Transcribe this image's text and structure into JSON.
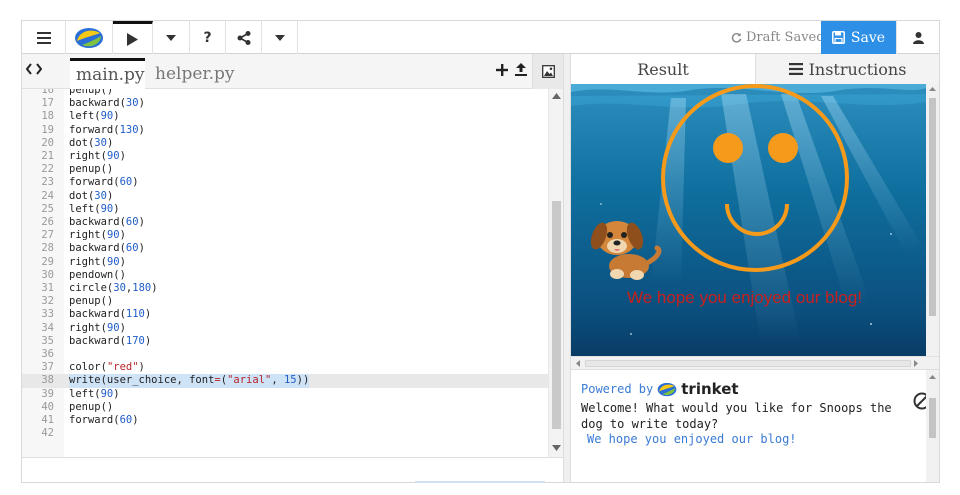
{
  "toolbar": {
    "items": [
      "menu-icon",
      "trinket-logo",
      "run-icon",
      "dropdown-icon",
      "help",
      "share-icon",
      "dropdown-icon"
    ],
    "help_label": "?",
    "draft_status": "Draft Saved",
    "save_label": "Save"
  },
  "editor": {
    "nav_arrows": "<>",
    "tabs": [
      {
        "label": "main.py",
        "active": true
      },
      {
        "label": "helper.py",
        "active": false
      }
    ],
    "lines": [
      {
        "n": "16",
        "code": "penup()"
      },
      {
        "n": "17",
        "code": "backward(30)"
      },
      {
        "n": "18",
        "code": "left(90)"
      },
      {
        "n": "19",
        "code": "forward(130)"
      },
      {
        "n": "20",
        "code": "dot(30)"
      },
      {
        "n": "21",
        "code": "right(90)"
      },
      {
        "n": "22",
        "code": "penup()"
      },
      {
        "n": "23",
        "code": "forward(60)"
      },
      {
        "n": "24",
        "code": "dot(30)"
      },
      {
        "n": "25",
        "code": "left(90)"
      },
      {
        "n": "26",
        "code": "backward(60)"
      },
      {
        "n": "27",
        "code": "right(90)"
      },
      {
        "n": "28",
        "code": "backward(60)"
      },
      {
        "n": "29",
        "code": "right(90)"
      },
      {
        "n": "30",
        "code": "pendown()"
      },
      {
        "n": "31",
        "code": "circle(30,180)"
      },
      {
        "n": "32",
        "code": "penup()"
      },
      {
        "n": "33",
        "code": "backward(110)"
      },
      {
        "n": "34",
        "code": "right(90)"
      },
      {
        "n": "35",
        "code": "backward(170)"
      },
      {
        "n": "36",
        "code": ""
      },
      {
        "n": "37",
        "code": "color(\"red\")"
      },
      {
        "n": "38",
        "code": "write(user_choice, font=(\"arial\", 15))",
        "highlight": true
      },
      {
        "n": "39",
        "code": "left(90)"
      },
      {
        "n": "40",
        "code": "penup()"
      },
      {
        "n": "41",
        "code": "forward(60)"
      },
      {
        "n": "42",
        "code": ""
      }
    ]
  },
  "result": {
    "tab_result": "Result",
    "tab_instructions": "Instructions",
    "canvas_text": "We hope you enjoyed our blog!",
    "canvas_text_color": "#c8201c",
    "smiley_color": "#f59a1b"
  },
  "console": {
    "powered_by": "Powered by",
    "brand": "trinket",
    "prompt": "Welcome! What would you like for Snoops the dog to write today?",
    "output": "We hope you enjoyed our blog!"
  },
  "colors": {
    "save_button": "#2d8fe6",
    "keyword_number": "#1f5cc8",
    "string": "#b8222a",
    "selection": "#cfe3f7"
  }
}
